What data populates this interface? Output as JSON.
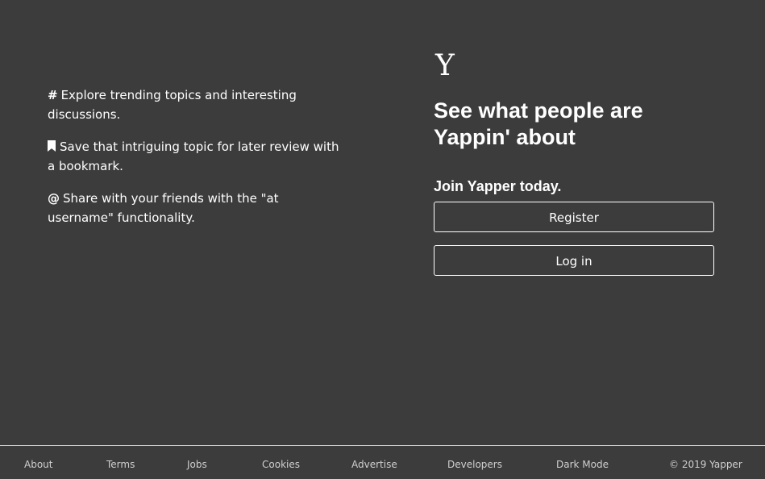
{
  "features": [
    {
      "icon": "hash-icon",
      "glyph": "#",
      "text": "Explore trending topics and interesting discussions."
    },
    {
      "icon": "bookmark-icon",
      "glyph": "",
      "text": "Save that intriguing topic for later review with a bookmark."
    },
    {
      "icon": "at-icon",
      "glyph": "@",
      "text": "Share with your friends with the \"at username\" functionality."
    }
  ],
  "brand": {
    "logo_letter": "Y"
  },
  "hero": {
    "headline": "See what people are Yappin' about",
    "join_text": "Join Yapper today.",
    "register_label": "Register",
    "login_label": "Log in"
  },
  "footer": {
    "about": "About",
    "terms": "Terms",
    "jobs": "Jobs",
    "cookies": "Cookies",
    "advertise": "Advertise",
    "developers": "Developers",
    "dark_mode": "Dark Mode",
    "copyright": "© 2019 Yapper"
  },
  "colors": {
    "background": "#3c3c3c",
    "text": "#ffffff",
    "footer_text": "#cfcfcf"
  }
}
